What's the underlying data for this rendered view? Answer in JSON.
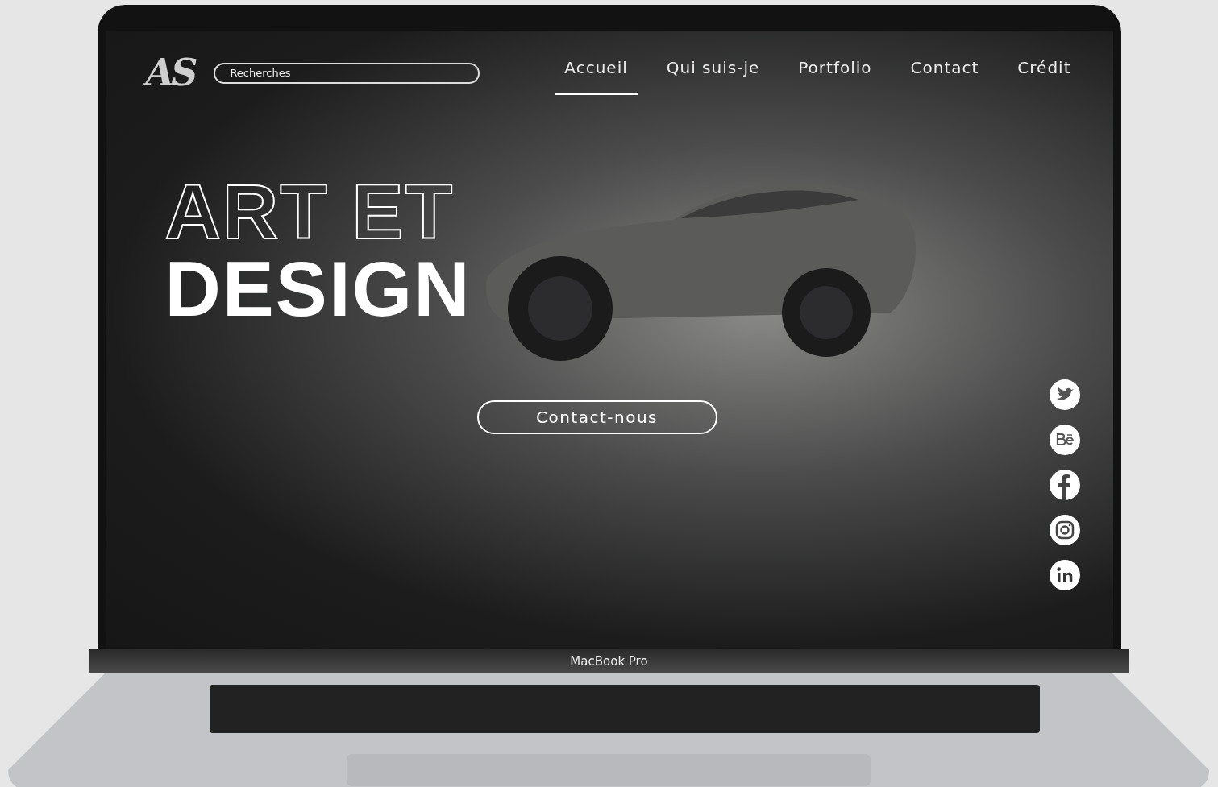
{
  "device": {
    "label": "MacBook Pro"
  },
  "header": {
    "logo": "AS",
    "search": {
      "placeholder": "Recherches"
    }
  },
  "nav": [
    {
      "label": "Accueil",
      "selected": true
    },
    {
      "label": "Qui suis-je",
      "selected": false
    },
    {
      "label": "Portfolio",
      "selected": false
    },
    {
      "label": "Contact",
      "selected": false
    },
    {
      "label": "Crédit",
      "selected": false
    }
  ],
  "hero": {
    "lines": [
      {
        "text": "ART ET",
        "kind": "outline"
      },
      {
        "text": "DESIGN",
        "kind": "solid"
      }
    ],
    "button": "Contact-nous"
  },
  "social": [
    {
      "kind": "twitter"
    },
    {
      "kind": "behance"
    },
    {
      "kind": "facebook"
    },
    {
      "kind": "instagram"
    },
    {
      "kind": "linkedin"
    }
  ]
}
